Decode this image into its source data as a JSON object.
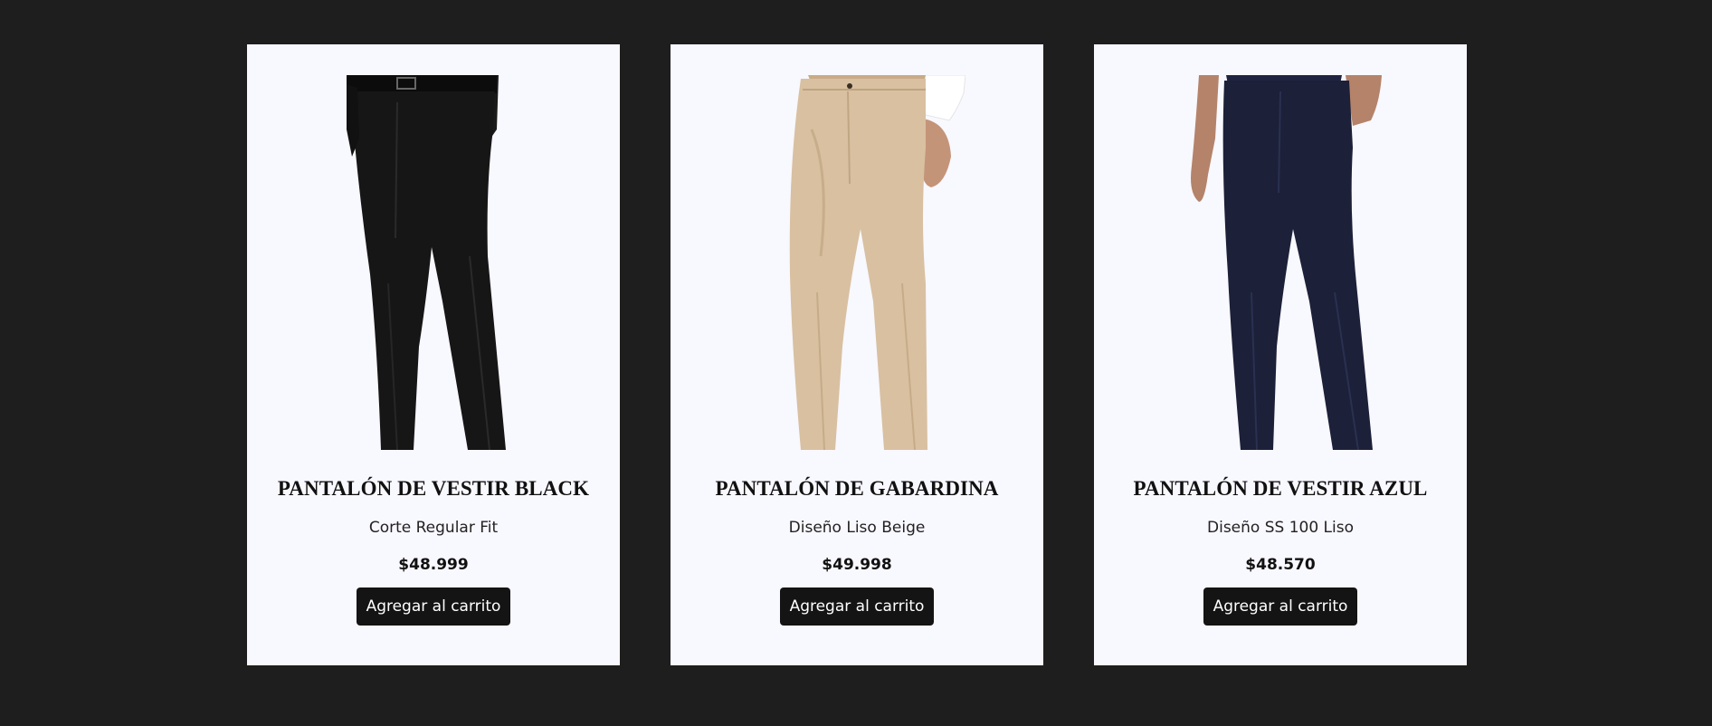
{
  "products": [
    {
      "title": "PANTALÓN DE VESTIR BLACK",
      "subtitle": "Corte Regular Fit",
      "price": "$48.999",
      "button_label": "Agregar al carrito",
      "image": "black-dress-pants-photo",
      "color": "#141414"
    },
    {
      "title": "PANTALÓN DE GABARDINA",
      "subtitle": "Diseño Liso Beige",
      "price": "$49.998",
      "button_label": "Agregar al carrito",
      "image": "beige-gabardine-pants-photo",
      "color": "#d7bfa0"
    },
    {
      "title": "PANTALÓN DE VESTIR AZUL",
      "subtitle": "Diseño SS 100 Liso",
      "price": "$48.570",
      "button_label": "Agregar al carrito",
      "image": "navy-dress-pants-photo",
      "color": "#1c2038"
    }
  ]
}
